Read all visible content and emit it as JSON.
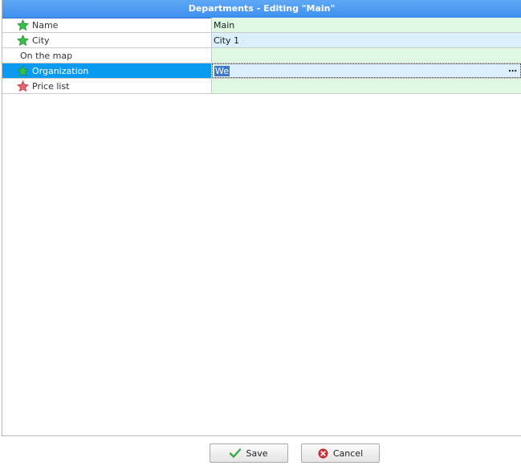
{
  "window": {
    "title": "Departments - Editing \"Main\""
  },
  "fields": [
    {
      "label": "Name",
      "value": "Main",
      "icon": "green-star-icon"
    },
    {
      "label": "City",
      "value": "City 1",
      "icon": "green-star-icon"
    },
    {
      "label": "On the map",
      "value": "",
      "icon": ""
    },
    {
      "label": "Organization",
      "value": "We",
      "icon": "green-star-icon"
    },
    {
      "label": "Price list",
      "value": "",
      "icon": "red-star-icon"
    }
  ],
  "colors": {
    "title_bar": "#3e8ff0",
    "selected_row": "#0a9bf0",
    "required_field_bg": "#dff9e3",
    "filled_field_bg": "#daf0fd"
  },
  "buttons": {
    "save_label": "Save",
    "cancel_label": "Cancel"
  }
}
